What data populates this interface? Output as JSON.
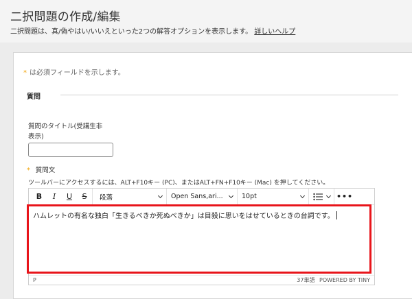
{
  "header": {
    "title": "二択問題の作成/編集",
    "description": "二択問題は、真/偽やはい/いいえといった2つの解答オプションを表示します。",
    "help_link": "詳しいヘルプ"
  },
  "form": {
    "required_note": "は必須フィールドを示します。",
    "required_mark": "*",
    "section_title": "質問",
    "title_field_label": "質問のタイトル(受講生非表示)",
    "title_field_value": "",
    "question_label": "質問文",
    "toolbar_hint": "ツールバーにアクセスするには、ALT+F10キー (PC)、またはALT+FN+F10キー (Mac) を押してください。"
  },
  "editor": {
    "toolbar": {
      "bold": "B",
      "italic": "I",
      "underline": "U",
      "strike": "S",
      "block_format": "段落",
      "font_family": "Open Sans,ari...",
      "font_size": "10pt",
      "more": "•••"
    },
    "content": "ハムレットの有名な独白「生きるべきか死ぬべきか」は目殺に思いをはせているときの台詞です。",
    "status_path": "P",
    "word_count": "37単語",
    "powered_by": "POWERED BY TINY"
  },
  "colors": {
    "highlight": "#e8141a",
    "required": "#f2a200"
  }
}
